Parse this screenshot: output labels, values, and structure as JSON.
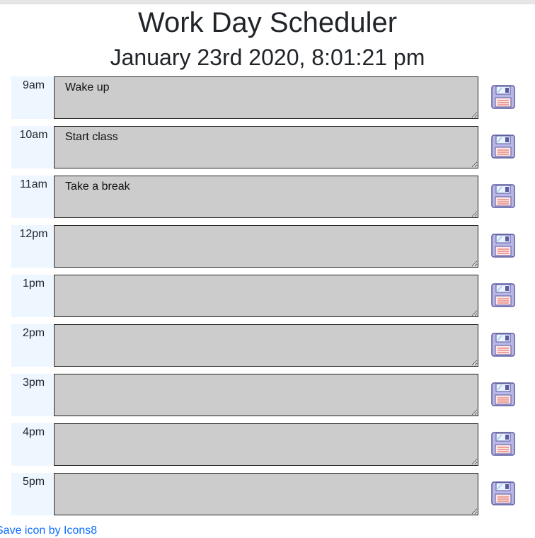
{
  "header": {
    "title": "Work Day Scheduler",
    "current_datetime": "January 23rd 2020, 8:01:21 pm"
  },
  "timeblocks": [
    {
      "hour": "9am",
      "text": "Wake up",
      "save_icon": "save-icon"
    },
    {
      "hour": "10am",
      "text": "Start class",
      "save_icon": "save-icon"
    },
    {
      "hour": "11am",
      "text": "Take a break",
      "save_icon": "save-icon"
    },
    {
      "hour": "12pm",
      "text": "",
      "save_icon": "save-icon"
    },
    {
      "hour": "1pm",
      "text": "",
      "save_icon": "save-icon"
    },
    {
      "hour": "2pm",
      "text": "",
      "save_icon": "save-icon"
    },
    {
      "hour": "3pm",
      "text": "",
      "save_icon": "save-icon"
    },
    {
      "hour": "4pm",
      "text": "",
      "save_icon": "save-icon"
    },
    {
      "hour": "5pm",
      "text": "",
      "save_icon": "save-icon"
    }
  ],
  "footer": {
    "credit_link": "Save icon by Icons8"
  },
  "colors": {
    "hour_bg": "#eef6ff",
    "textarea_bg": "#cccccc",
    "link": "#0d6efd"
  }
}
